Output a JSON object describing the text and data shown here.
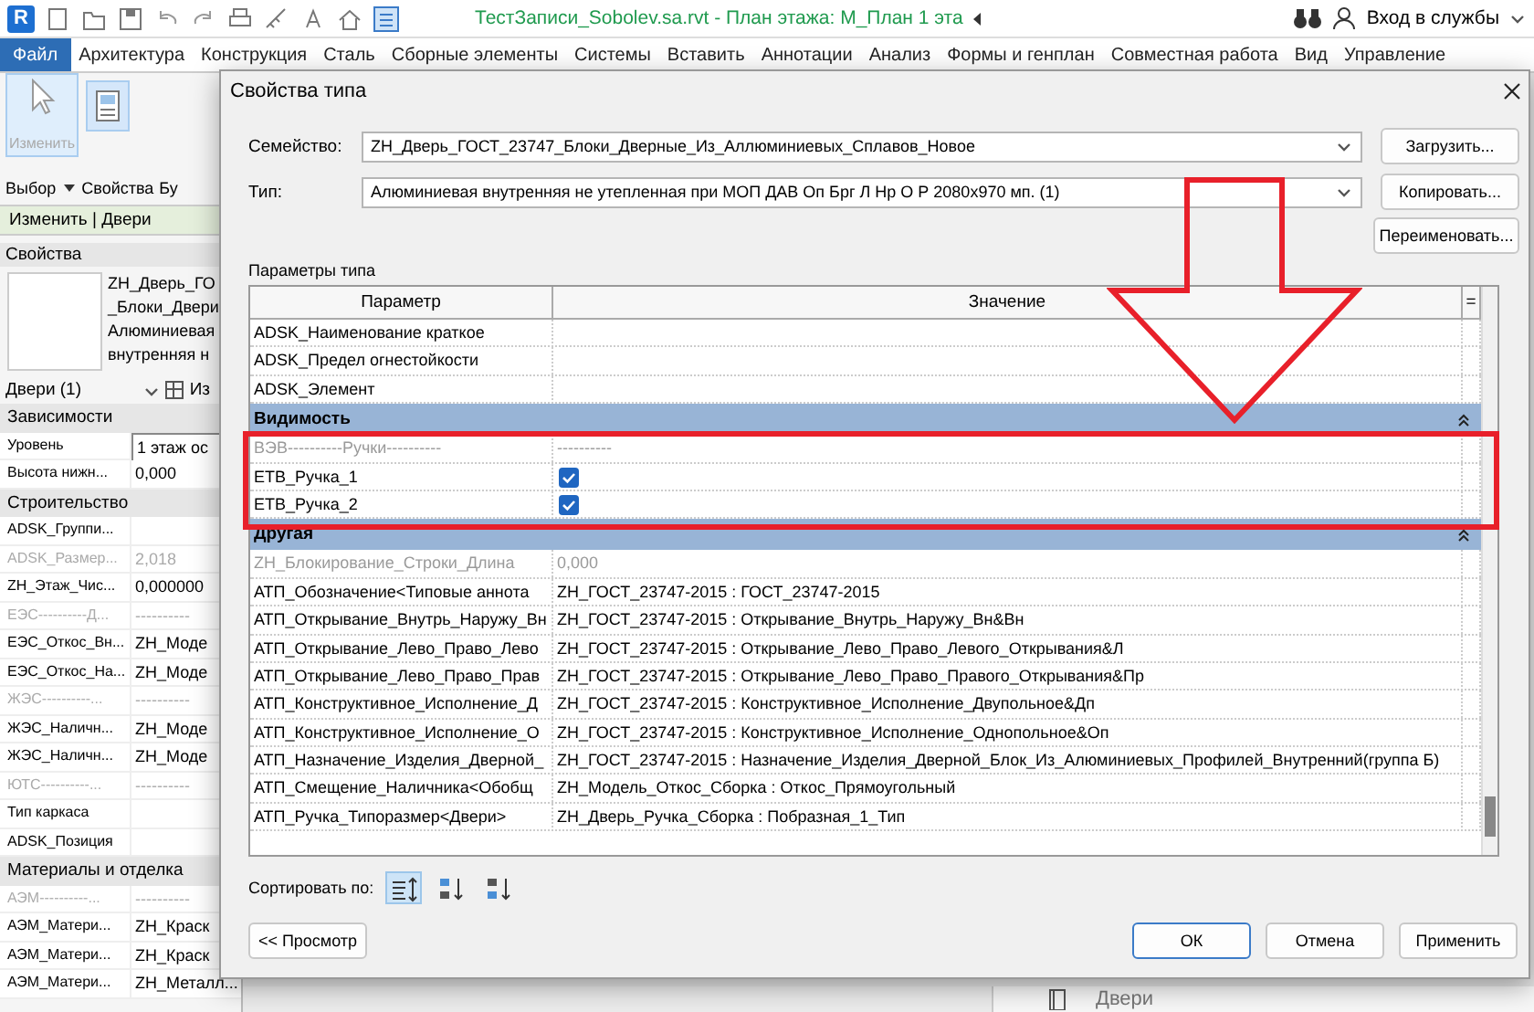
{
  "title_bar": {
    "logo": "R",
    "title": "ТестЗаписи_Sobolev.sa.rvt - План этажа: М_План 1 эта",
    "account": "Вход в службы"
  },
  "ribbon_tabs": [
    {
      "label": "Файл",
      "selected": true
    },
    {
      "label": "Архитектура",
      "selected": false
    },
    {
      "label": "Конструкция",
      "selected": false
    },
    {
      "label": "Сталь",
      "selected": false
    },
    {
      "label": "Сборные элементы",
      "selected": false
    },
    {
      "label": "Системы",
      "selected": false
    },
    {
      "label": "Вставить",
      "selected": false
    },
    {
      "label": "Аннотации",
      "selected": false
    },
    {
      "label": "Анализ",
      "selected": false
    },
    {
      "label": "Формы и генплан",
      "selected": false
    },
    {
      "label": "Совместная работа",
      "selected": false
    },
    {
      "label": "Вид",
      "selected": false
    },
    {
      "label": "Управление",
      "selected": false
    }
  ],
  "ribbon_panel": {
    "modify_label": "Изменить",
    "select_label": "Выбор",
    "properties_label": "Свойства",
    "cut_label": "Бу",
    "context_label": "Изменить | Двери"
  },
  "properties_palette": {
    "title": "Свойства",
    "type_lines": [
      "ZH_Дверь_ГО",
      "_Блоки_Двери",
      "Алюминиевая",
      "внутренняя н"
    ],
    "category": "Двери (1)",
    "edit_type": "Из",
    "groups": [
      {
        "name": "Зависимости",
        "rows": [
          {
            "name": "Уровень",
            "value": "1 этаж ос",
            "disabled": false
          },
          {
            "name": "Высота нижн...",
            "value": "0,000",
            "disabled": false
          }
        ]
      },
      {
        "name": "Строительство",
        "rows": [
          {
            "name": "ADSK_Группи...",
            "value": "",
            "disabled": false
          },
          {
            "name": "ADSK_Размер...",
            "value": "2,018",
            "disabled": true
          },
          {
            "name": "ZH_Этаж_Чис...",
            "value": "0,000000",
            "disabled": false
          },
          {
            "name": "ЕЭС----------Д...",
            "value": "----------",
            "disabled": true
          },
          {
            "name": "ЕЭС_Откос_Вн...",
            "value": "ZH_Моде",
            "disabled": false
          },
          {
            "name": "ЕЭС_Откос_На...",
            "value": "ZH_Моде",
            "disabled": false
          },
          {
            "name": "ЖЭС----------...",
            "value": "----------",
            "disabled": true
          },
          {
            "name": "ЖЭС_Наличн...",
            "value": "ZH_Моде",
            "disabled": false
          },
          {
            "name": "ЖЭС_Наличн...",
            "value": "ZH_Моде",
            "disabled": false
          },
          {
            "name": "ЮТС----------...",
            "value": "----------",
            "disabled": true
          },
          {
            "name": "Тип каркаса",
            "value": "",
            "disabled": false
          },
          {
            "name": "ADSK_Позиция",
            "value": "",
            "disabled": false
          }
        ]
      },
      {
        "name": "Материалы и отделка",
        "rows": [
          {
            "name": "АЭМ----------...",
            "value": "----------",
            "disabled": true
          },
          {
            "name": "АЭМ_Матери...",
            "value": "ZH_Краск",
            "disabled": false
          },
          {
            "name": "АЭМ_Матери...",
            "value": "ZH_Краск",
            "disabled": false
          },
          {
            "name": "АЭМ_Матери...",
            "value": "ZH_Металл...",
            "disabled": false
          }
        ]
      }
    ]
  },
  "dialog": {
    "title": "Свойства типа",
    "family_label": "Семейство:",
    "family": "ZH_Дверь_ГОСТ_23747_Блоки_Дверные_Из_Аллюминиевых_Сплавов_Новое",
    "load_button": "Загрузить...",
    "type_label": "Тип:",
    "type": "Алюминиевая внутренняя не утепленная при МОП ДАВ Оп Брг Л Нр О Р 2080х970 мп. (1)",
    "copy_button": "Копировать...",
    "rename_button": "Переименовать...",
    "params_label": "Параметры типа",
    "table": {
      "columns": [
        "Параметр",
        "Значение",
        "="
      ],
      "rows": [
        {
          "kind": "text",
          "name": "ADSK_Наименование краткое",
          "value": "",
          "disabled": false
        },
        {
          "kind": "text",
          "name": "ADSK_Предел огнестойкости",
          "value": "",
          "disabled": false
        },
        {
          "kind": "text",
          "name": "ADSK_Элемент",
          "value": "",
          "disabled": false
        },
        {
          "kind": "group",
          "name": "Видимость",
          "expanded": true
        },
        {
          "kind": "text",
          "name": "ВЭВ----------Ручки----------",
          "value": "----------",
          "disabled": true
        },
        {
          "kind": "checkbox",
          "name": "ЕТВ_Ручка_1",
          "checked": true
        },
        {
          "kind": "checkbox",
          "name": "ЕТВ_Ручка_2",
          "checked": true
        },
        {
          "kind": "group",
          "name": "Другая",
          "expanded": true
        },
        {
          "kind": "text",
          "name": "ZH_Блокирование_Строки_Длина",
          "value": "0,000",
          "disabled": true
        },
        {
          "kind": "text",
          "name": "АТП_Обозначение<Типовые аннота",
          "value": "ZH_ГОСТ_23747-2015 : ГОСТ_23747-2015",
          "disabled": false
        },
        {
          "kind": "text",
          "name": "АТП_Открывание_Внутрь_Наружу_Вн",
          "value": "ZH_ГОСТ_23747-2015 : Открывание_Внутрь_Наружу_Вн&Вн",
          "disabled": false
        },
        {
          "kind": "text",
          "name": "АТП_Открывание_Лево_Право_Лево",
          "value": "ZH_ГОСТ_23747-2015 : Открывание_Лево_Право_Левого_Открывания&Л",
          "disabled": false
        },
        {
          "kind": "text",
          "name": "АТП_Открывание_Лево_Право_Прав",
          "value": "ZH_ГОСТ_23747-2015 : Открывание_Лево_Право_Правого_Открывания&Пр",
          "disabled": false
        },
        {
          "kind": "text",
          "name": "АТП_Конструктивное_Исполнение_Д",
          "value": "ZH_ГОСТ_23747-2015 : Конструктивное_Исполнение_Двупольное&Дп",
          "disabled": false
        },
        {
          "kind": "text",
          "name": "АТП_Конструктивное_Исполнение_О",
          "value": "ZH_ГОСТ_23747-2015 : Конструктивное_Исполнение_Однопольное&Оп",
          "disabled": false
        },
        {
          "kind": "text",
          "name": "АТП_Назначение_Изделия_Дверной_",
          "value": "ZH_ГОСТ_23747-2015 : Назначение_Изделия_Дверной_Блок_Из_Алюминиевых_Профилей_Внутренний(группа Б)",
          "disabled": false
        },
        {
          "kind": "text",
          "name": "АТП_Смещение_Наличника<Обобщ",
          "value": "ZH_Модель_Откос_Сборка : Откос_Прямоугольный",
          "disabled": false
        },
        {
          "kind": "text",
          "name": "АТП_Ручка_Типоразмер<Двери>",
          "value": "ZH_Дверь_Ручка_Сборка : Побразная_1_Тип",
          "disabled": false
        }
      ]
    },
    "sort_label": "Сортировать по:",
    "sort_modes": [
      {
        "kind": "grouped",
        "selected": true
      },
      {
        "kind": "az",
        "selected": false
      },
      {
        "kind": "za",
        "selected": false
      }
    ],
    "preview_button": "<< Просмотр",
    "ok_button": "ОК",
    "cancel_button": "Отмена",
    "apply_button": "Применить"
  },
  "background_panel": {
    "label": "Двери"
  },
  "annotations": {
    "highlight_frame": true,
    "arrow": true
  }
}
